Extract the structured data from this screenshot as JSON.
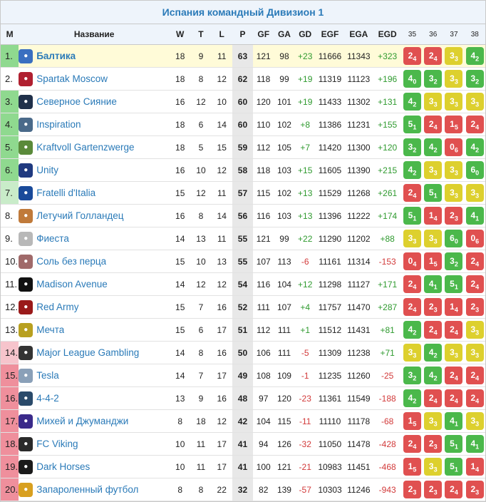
{
  "title": "Испания командный Дивизион 1",
  "headers": {
    "m": "М",
    "name": "Название",
    "w": "W",
    "t": "T",
    "l": "L",
    "p": "P",
    "gf": "GF",
    "ga": "GA",
    "gd": "GD",
    "egf": "EGF",
    "ega": "EGA",
    "egd": "EGD",
    "rounds": [
      "35",
      "36",
      "37",
      "38"
    ]
  },
  "colors": {
    "accent": "#2a7ab8",
    "win": "#4bb84b",
    "draw": "#ddd02e",
    "loss": "#e05050",
    "promotion": "#8fd98f",
    "relegation": "#ef8f9c",
    "highlight": "#fffbd8"
  },
  "rows": [
    {
      "pos": "1.",
      "zone": "green",
      "name": "Балтика",
      "logo_color": "#3a6fc0",
      "w": "18",
      "t": "9",
      "l": "11",
      "p": "63",
      "gf": "121",
      "ga": "98",
      "gd": "+23",
      "egf": "11666",
      "ega": "11343",
      "egd": "+323",
      "results": [
        [
          "l",
          "2",
          "4"
        ],
        [
          "l",
          "2",
          "4"
        ],
        [
          "d",
          "3",
          "3"
        ],
        [
          "w",
          "4",
          "2"
        ]
      ]
    },
    {
      "pos": "2.",
      "zone": "white",
      "name": "Spartak Moscow",
      "logo_color": "#b02030",
      "w": "18",
      "t": "8",
      "l": "12",
      "p": "62",
      "gf": "118",
      "ga": "99",
      "gd": "+19",
      "egf": "11319",
      "ega": "11123",
      "egd": "+196",
      "results": [
        [
          "w",
          "4",
          "0"
        ],
        [
          "w",
          "3",
          "2"
        ],
        [
          "d",
          "3",
          "3"
        ],
        [
          "w",
          "3",
          "2"
        ]
      ]
    },
    {
      "pos": "3.",
      "zone": "green",
      "name": "Северное Сияние",
      "logo_color": "#20304a",
      "w": "16",
      "t": "12",
      "l": "10",
      "p": "60",
      "gf": "120",
      "ga": "101",
      "gd": "+19",
      "egf": "11433",
      "ega": "11302",
      "egd": "+131",
      "results": [
        [
          "w",
          "4",
          "2"
        ],
        [
          "d",
          "3",
          "3"
        ],
        [
          "d",
          "3",
          "3"
        ],
        [
          "d",
          "3",
          "3"
        ]
      ]
    },
    {
      "pos": "4.",
      "zone": "green",
      "name": "Inspiration",
      "logo_color": "#4a6a8a",
      "w": "18",
      "t": "6",
      "l": "14",
      "p": "60",
      "gf": "110",
      "ga": "102",
      "gd": "+8",
      "egf": "11386",
      "ega": "11231",
      "egd": "+155",
      "results": [
        [
          "w",
          "5",
          "1"
        ],
        [
          "l",
          "2",
          "4"
        ],
        [
          "l",
          "1",
          "5"
        ],
        [
          "l",
          "2",
          "4"
        ]
      ]
    },
    {
      "pos": "5.",
      "zone": "green",
      "name": "Kraftvoll Gartenzwerge",
      "logo_color": "#5a8a3a",
      "w": "18",
      "t": "5",
      "l": "15",
      "p": "59",
      "gf": "112",
      "ga": "105",
      "gd": "+7",
      "egf": "11420",
      "ega": "11300",
      "egd": "+120",
      "results": [
        [
          "w",
          "3",
          "2"
        ],
        [
          "w",
          "4",
          "2"
        ],
        [
          "l",
          "0",
          "6"
        ],
        [
          "w",
          "4",
          "2"
        ]
      ]
    },
    {
      "pos": "6.",
      "zone": "green",
      "name": "Unity",
      "logo_color": "#203a80",
      "w": "16",
      "t": "10",
      "l": "12",
      "p": "58",
      "gf": "118",
      "ga": "103",
      "gd": "+15",
      "egf": "11605",
      "ega": "11390",
      "egd": "+215",
      "results": [
        [
          "w",
          "4",
          "2"
        ],
        [
          "d",
          "3",
          "3"
        ],
        [
          "d",
          "3",
          "3"
        ],
        [
          "w",
          "6",
          "0"
        ]
      ]
    },
    {
      "pos": "7.",
      "zone": "lgreen",
      "name": "Fratelli d'Italia",
      "logo_color": "#1a4a9a",
      "w": "15",
      "t": "12",
      "l": "11",
      "p": "57",
      "gf": "115",
      "ga": "102",
      "gd": "+13",
      "egf": "11529",
      "ega": "11268",
      "egd": "+261",
      "results": [
        [
          "l",
          "2",
          "4"
        ],
        [
          "w",
          "5",
          "1"
        ],
        [
          "d",
          "3",
          "3"
        ],
        [
          "d",
          "3",
          "3"
        ]
      ]
    },
    {
      "pos": "8.",
      "zone": "white",
      "name": "Летучий Голландец",
      "logo_color": "#c07a3a",
      "w": "16",
      "t": "8",
      "l": "14",
      "p": "56",
      "gf": "116",
      "ga": "103",
      "gd": "+13",
      "egf": "11396",
      "ega": "11222",
      "egd": "+174",
      "results": [
        [
          "w",
          "5",
          "1"
        ],
        [
          "l",
          "1",
          "4"
        ],
        [
          "l",
          "2",
          "3"
        ],
        [
          "w",
          "4",
          "1"
        ]
      ]
    },
    {
      "pos": "9.",
      "zone": "white",
      "name": "Фиеста",
      "logo_color": "#b8b8b8",
      "w": "14",
      "t": "13",
      "l": "11",
      "p": "55",
      "gf": "121",
      "ga": "99",
      "gd": "+22",
      "egf": "11290",
      "ega": "11202",
      "egd": "+88",
      "results": [
        [
          "d",
          "3",
          "3"
        ],
        [
          "d",
          "3",
          "3"
        ],
        [
          "w",
          "6",
          "0"
        ],
        [
          "l",
          "0",
          "6"
        ]
      ]
    },
    {
      "pos": "10.",
      "zone": "white",
      "name": "Соль без перца",
      "logo_color": "#a06a6a",
      "w": "15",
      "t": "10",
      "l": "13",
      "p": "55",
      "gf": "107",
      "ga": "113",
      "gd": "-6",
      "egf": "11161",
      "ega": "11314",
      "egd": "-153",
      "results": [
        [
          "l",
          "0",
          "4"
        ],
        [
          "l",
          "1",
          "5"
        ],
        [
          "w",
          "3",
          "2"
        ],
        [
          "l",
          "2",
          "4"
        ]
      ]
    },
    {
      "pos": "11.",
      "zone": "white",
      "name": "Madison Avenue",
      "logo_color": "#111111",
      "w": "14",
      "t": "12",
      "l": "12",
      "p": "54",
      "gf": "116",
      "ga": "104",
      "gd": "+12",
      "egf": "11298",
      "ega": "11127",
      "egd": "+171",
      "results": [
        [
          "l",
          "2",
          "4"
        ],
        [
          "w",
          "4",
          "1"
        ],
        [
          "w",
          "5",
          "1"
        ],
        [
          "l",
          "2",
          "4"
        ]
      ]
    },
    {
      "pos": "12.",
      "zone": "white",
      "name": "Red Army",
      "logo_color": "#9a1a1a",
      "w": "15",
      "t": "7",
      "l": "16",
      "p": "52",
      "gf": "111",
      "ga": "107",
      "gd": "+4",
      "egf": "11757",
      "ega": "11470",
      "egd": "+287",
      "results": [
        [
          "l",
          "2",
          "4"
        ],
        [
          "l",
          "2",
          "3"
        ],
        [
          "l",
          "1",
          "4"
        ],
        [
          "l",
          "2",
          "3"
        ]
      ]
    },
    {
      "pos": "13.",
      "zone": "white",
      "name": "Мечта",
      "logo_color": "#b8a020",
      "w": "15",
      "t": "6",
      "l": "17",
      "p": "51",
      "gf": "112",
      "ga": "111",
      "gd": "+1",
      "egf": "11512",
      "ega": "11431",
      "egd": "+81",
      "results": [
        [
          "w",
          "4",
          "2"
        ],
        [
          "l",
          "2",
          "4"
        ],
        [
          "l",
          "2",
          "4"
        ],
        [
          "d",
          "3",
          "3"
        ]
      ]
    },
    {
      "pos": "14.",
      "zone": "pink",
      "name": "Major League Gambling",
      "logo_color": "#333333",
      "w": "14",
      "t": "8",
      "l": "16",
      "p": "50",
      "gf": "106",
      "ga": "111",
      "gd": "-5",
      "egf": "11309",
      "ega": "11238",
      "egd": "+71",
      "results": [
        [
          "d",
          "3",
          "3"
        ],
        [
          "w",
          "4",
          "2"
        ],
        [
          "d",
          "3",
          "3"
        ],
        [
          "d",
          "3",
          "3"
        ]
      ]
    },
    {
      "pos": "15.",
      "zone": "red",
      "name": "Tesla",
      "logo_color": "#8aa0b8",
      "w": "14",
      "t": "7",
      "l": "17",
      "p": "49",
      "gf": "108",
      "ga": "109",
      "gd": "-1",
      "egf": "11235",
      "ega": "11260",
      "egd": "-25",
      "results": [
        [
          "w",
          "3",
          "2"
        ],
        [
          "w",
          "4",
          "2"
        ],
        [
          "l",
          "2",
          "4"
        ],
        [
          "l",
          "2",
          "4"
        ]
      ]
    },
    {
      "pos": "16.",
      "zone": "red",
      "name": "4-4-2",
      "logo_color": "#2a4a6a",
      "w": "13",
      "t": "9",
      "l": "16",
      "p": "48",
      "gf": "97",
      "ga": "120",
      "gd": "-23",
      "egf": "11361",
      "ega": "11549",
      "egd": "-188",
      "results": [
        [
          "w",
          "4",
          "2"
        ],
        [
          "l",
          "2",
          "4"
        ],
        [
          "l",
          "2",
          "4"
        ],
        [
          "l",
          "2",
          "4"
        ]
      ]
    },
    {
      "pos": "17.",
      "zone": "red",
      "name": "Михей и Джуманджи",
      "logo_color": "#3a2a8a",
      "w": "8",
      "t": "18",
      "l": "12",
      "p": "42",
      "gf": "104",
      "ga": "115",
      "gd": "-11",
      "egf": "11110",
      "ega": "11178",
      "egd": "-68",
      "results": [
        [
          "l",
          "1",
          "5"
        ],
        [
          "d",
          "3",
          "3"
        ],
        [
          "w",
          "4",
          "1"
        ],
        [
          "d",
          "3",
          "3"
        ]
      ]
    },
    {
      "pos": "18.",
      "zone": "red",
      "name": "FC Viking",
      "logo_color": "#2a2a2a",
      "w": "10",
      "t": "11",
      "l": "17",
      "p": "41",
      "gf": "94",
      "ga": "126",
      "gd": "-32",
      "egf": "11050",
      "ega": "11478",
      "egd": "-428",
      "results": [
        [
          "l",
          "2",
          "4"
        ],
        [
          "l",
          "2",
          "3"
        ],
        [
          "w",
          "5",
          "1"
        ],
        [
          "w",
          "4",
          "1"
        ]
      ]
    },
    {
      "pos": "19.",
      "zone": "red",
      "name": "Dark Horses",
      "logo_color": "#1a1a1a",
      "w": "10",
      "t": "11",
      "l": "17",
      "p": "41",
      "gf": "100",
      "ga": "121",
      "gd": "-21",
      "egf": "10983",
      "ega": "11451",
      "egd": "-468",
      "results": [
        [
          "l",
          "1",
          "5"
        ],
        [
          "d",
          "3",
          "3"
        ],
        [
          "w",
          "5",
          "1"
        ],
        [
          "l",
          "1",
          "4"
        ]
      ]
    },
    {
      "pos": "20.",
      "zone": "red",
      "name": "Запароленный футбол",
      "logo_color": "#d8a020",
      "w": "8",
      "t": "8",
      "l": "22",
      "p": "32",
      "gf": "82",
      "ga": "139",
      "gd": "-57",
      "egf": "10303",
      "ega": "11246",
      "egd": "-943",
      "results": [
        [
          "l",
          "2",
          "3"
        ],
        [
          "l",
          "2",
          "3"
        ],
        [
          "l",
          "2",
          "4"
        ],
        [
          "l",
          "2",
          "3"
        ]
      ]
    }
  ]
}
